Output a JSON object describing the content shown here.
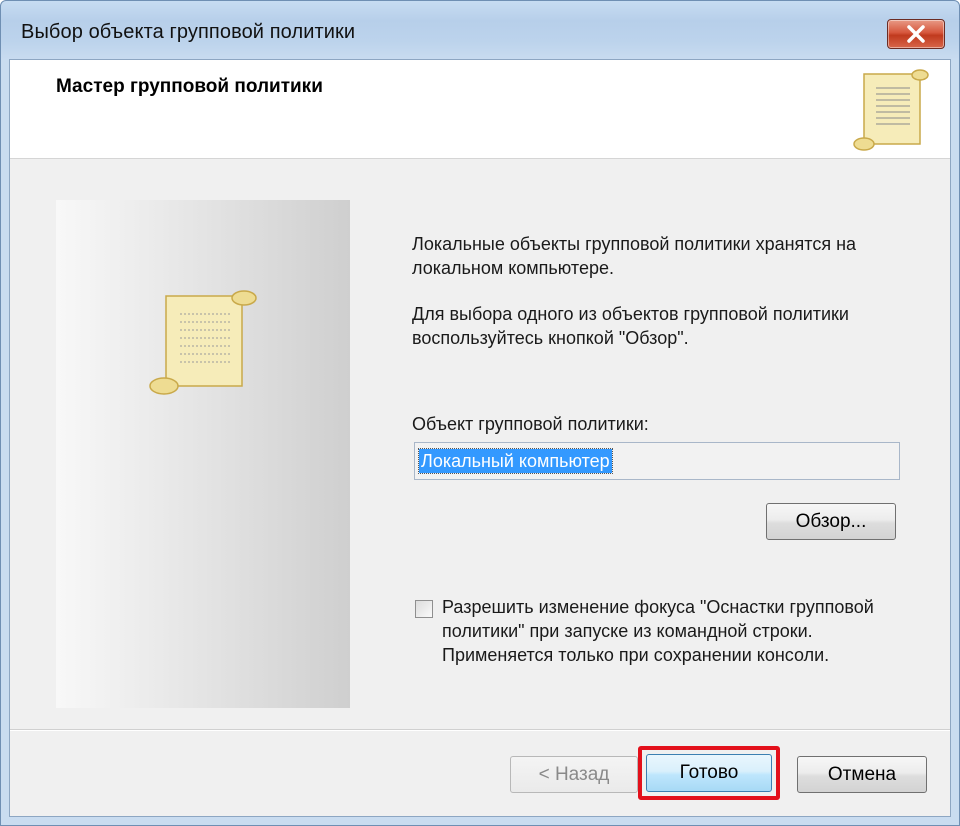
{
  "window": {
    "title": "Выбор объекта групповой политики"
  },
  "header": {
    "title": "Мастер групповой политики",
    "icon": "scroll-icon"
  },
  "side_panel": {
    "icon": "scroll-icon"
  },
  "content": {
    "description_1": "Локальные объекты групповой политики хранятся на локальном компьютере.",
    "description_2": "Для выбора одного из объектов групповой политики воспользуйтесь кнопкой \"Обзор\".",
    "gpo_label": "Объект групповой политики:",
    "gpo_value": "Локальный компьютер",
    "browse_label": "Обзор...",
    "allow_focus_checkbox": {
      "checked": false,
      "label": "Разрешить изменение фокуса \"Оснастки групповой политики\" при запуске из командной строки. Применяется только при сохранении консоли."
    }
  },
  "footer": {
    "back_label": "< Назад",
    "finish_label": "Готово",
    "cancel_label": "Отмена"
  },
  "colors": {
    "highlight": "#e3101b",
    "selection": "#3399ff",
    "close_button": "#c8432a"
  }
}
